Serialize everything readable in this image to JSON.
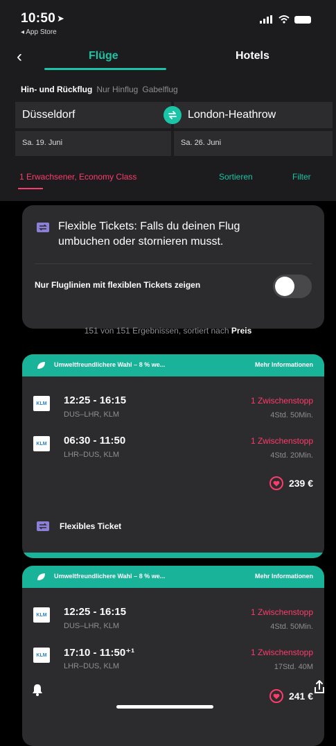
{
  "status_bar": {
    "time": "10:50",
    "back_app": "◂ App Store"
  },
  "nav": {
    "back_label": "‹",
    "tabs": [
      "Flüge",
      "Hotels"
    ]
  },
  "trip_types": [
    "Hin- und Rückflug",
    "Nur Hinflug",
    "Gabelflug"
  ],
  "search": {
    "from": "Düsseldorf",
    "to": "London-Heathrow",
    "depart_date": "Sa. 19. Juni",
    "return_date": "Sa. 26. Juni",
    "passengers": "1 Erwachsener, Economy Class",
    "sort_label": "Sortieren",
    "filter_label": "Filter"
  },
  "flex_info": {
    "text": "Flexible Tickets: Falls du deinen Flug umbuchen oder stornieren musst.",
    "toggle_label": "Nur Fluglinien mit flexiblen Tickets zeigen",
    "toggle_on": false
  },
  "results_summary": {
    "prefix": "151 von 151 Ergebnissen, sortiert nach",
    "sort_key": "Preis"
  },
  "results": [
    {
      "eco_label": "Umweltfreundlichere Wahl – 8 % we...",
      "more_info": "Mehr Informationen",
      "legs": [
        {
          "time": "12:25 - 16:15",
          "route": "DUS–LHR, KLM",
          "stops": "1 Zwischenstopp",
          "duration": "4Std. 50Min."
        },
        {
          "time": "06:30 - 11:50",
          "route": "LHR–DUS, KLM",
          "stops": "1 Zwischenstopp",
          "duration": "4Std. 20Min."
        }
      ],
      "price": "239 €",
      "flex_label": "Flexibles Ticket"
    },
    {
      "eco_label": "Umweltfreundlichere Wahl – 8 % we...",
      "more_info": "Mehr Informationen",
      "legs": [
        {
          "time": "12:25 - 16:15",
          "route": "DUS–LHR, KLM",
          "stops": "1 Zwischenstopp",
          "duration": "4Std. 50Min."
        },
        {
          "time": "17:10 - 11:50⁺¹",
          "route": "LHR–DUS, KLM",
          "stops": "1 Zwischenstopp",
          "duration": "17Std. 40M"
        }
      ],
      "price": "241 €"
    }
  ],
  "airline_logo_text": "KLM",
  "colors": {
    "accent": "#19c5a6",
    "alert": "#ff3b6b",
    "card": "#2c2c2e",
    "header": "#1c1c1e"
  }
}
